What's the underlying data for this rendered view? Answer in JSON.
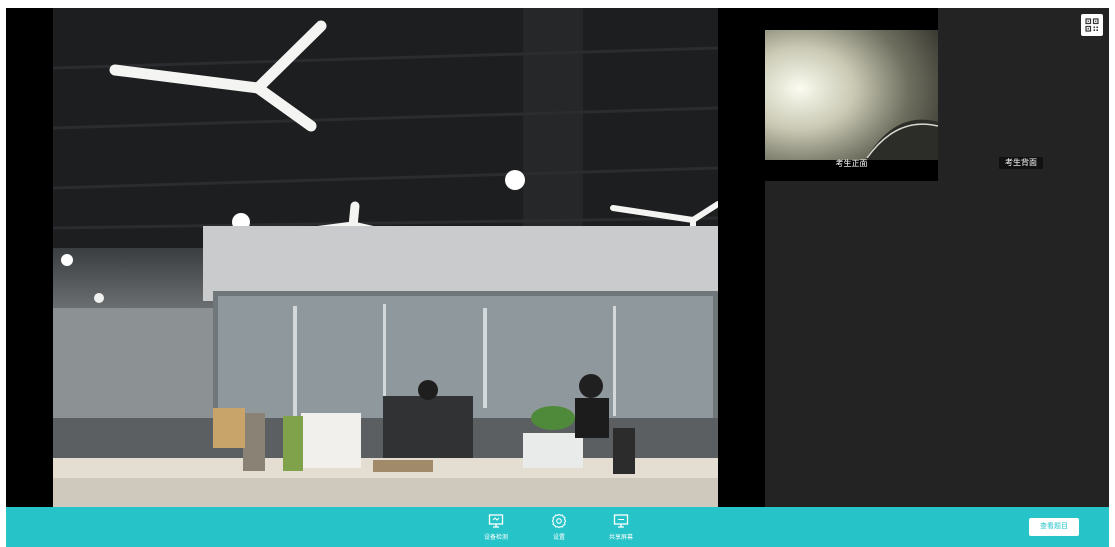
{
  "side_panel": {
    "front_camera_label": "考生正面",
    "back_camera_label": "考生背面",
    "qr_icon": "qr-code-icon"
  },
  "toolbar": {
    "device_check_label": "设备检测",
    "device_check_icon": "monitor-icon",
    "settings_label": "设置",
    "settings_icon": "gear-icon",
    "share_screen_label": "共享屏幕",
    "share_screen_icon": "screen-share-icon",
    "view_questions_label": "查看题目"
  },
  "colors": {
    "toolbar_bg": "#26c4c9",
    "panel_bg": "#232323",
    "video_bg": "#000000"
  }
}
